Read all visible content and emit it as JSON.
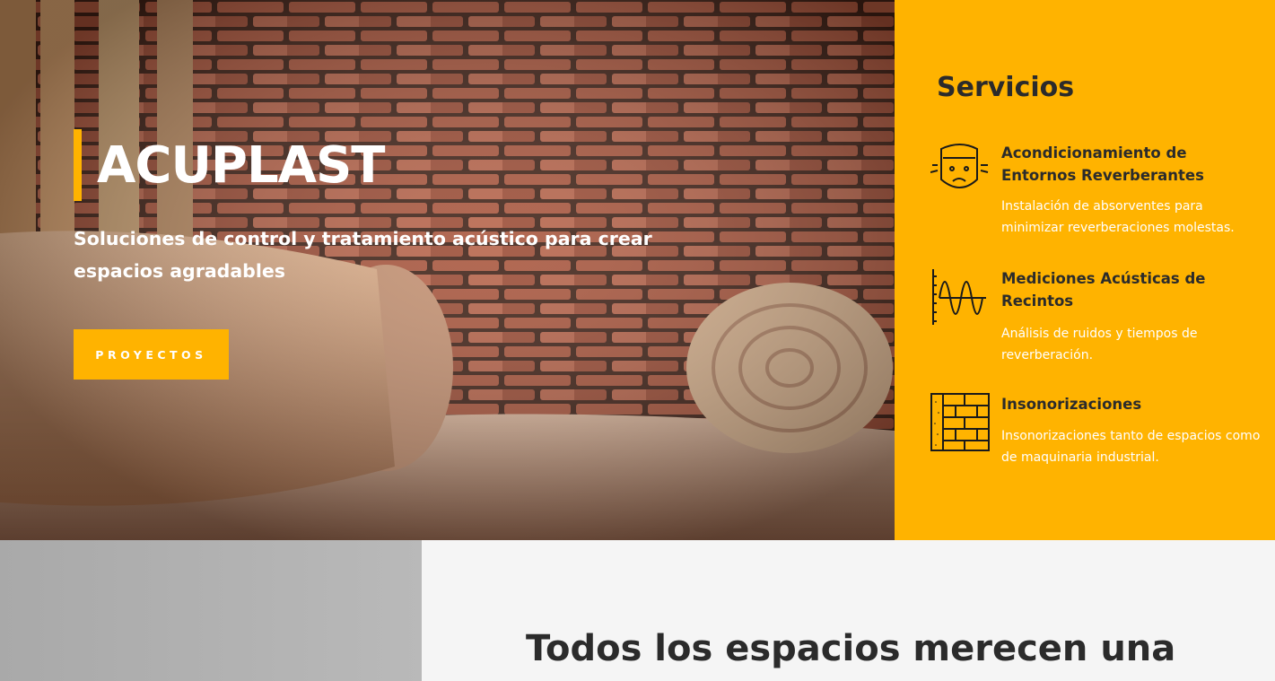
{
  "hero": {
    "title": "ACUPLAST",
    "subtitle": "Soluciones de control y tratamiento acústico para crear espacios agradables",
    "button_label": "PROYECTOS"
  },
  "services": {
    "title": "Servicios",
    "items": [
      {
        "icon": "worried-face-icon",
        "heading": "Acondicionamiento de Entornos Reverberantes",
        "text": "Instalación de absorventes para minimizar reverberaciones molestas."
      },
      {
        "icon": "sound-wave-icon",
        "heading": "Mediciones Acústicas de Recintos",
        "text": "Análisis de ruidos y tiempos de reverberación."
      },
      {
        "icon": "brick-wall-icon",
        "heading": "Insonorizaciones",
        "text": "Insonorizaciones tanto de espacios como de maquinaria industrial."
      }
    ]
  },
  "lower": {
    "heading": "Todos los espacios merecen una"
  },
  "colors": {
    "accent": "#ffb300",
    "dark_text": "#2b2b2b",
    "light_bg": "#f5f5f5"
  }
}
